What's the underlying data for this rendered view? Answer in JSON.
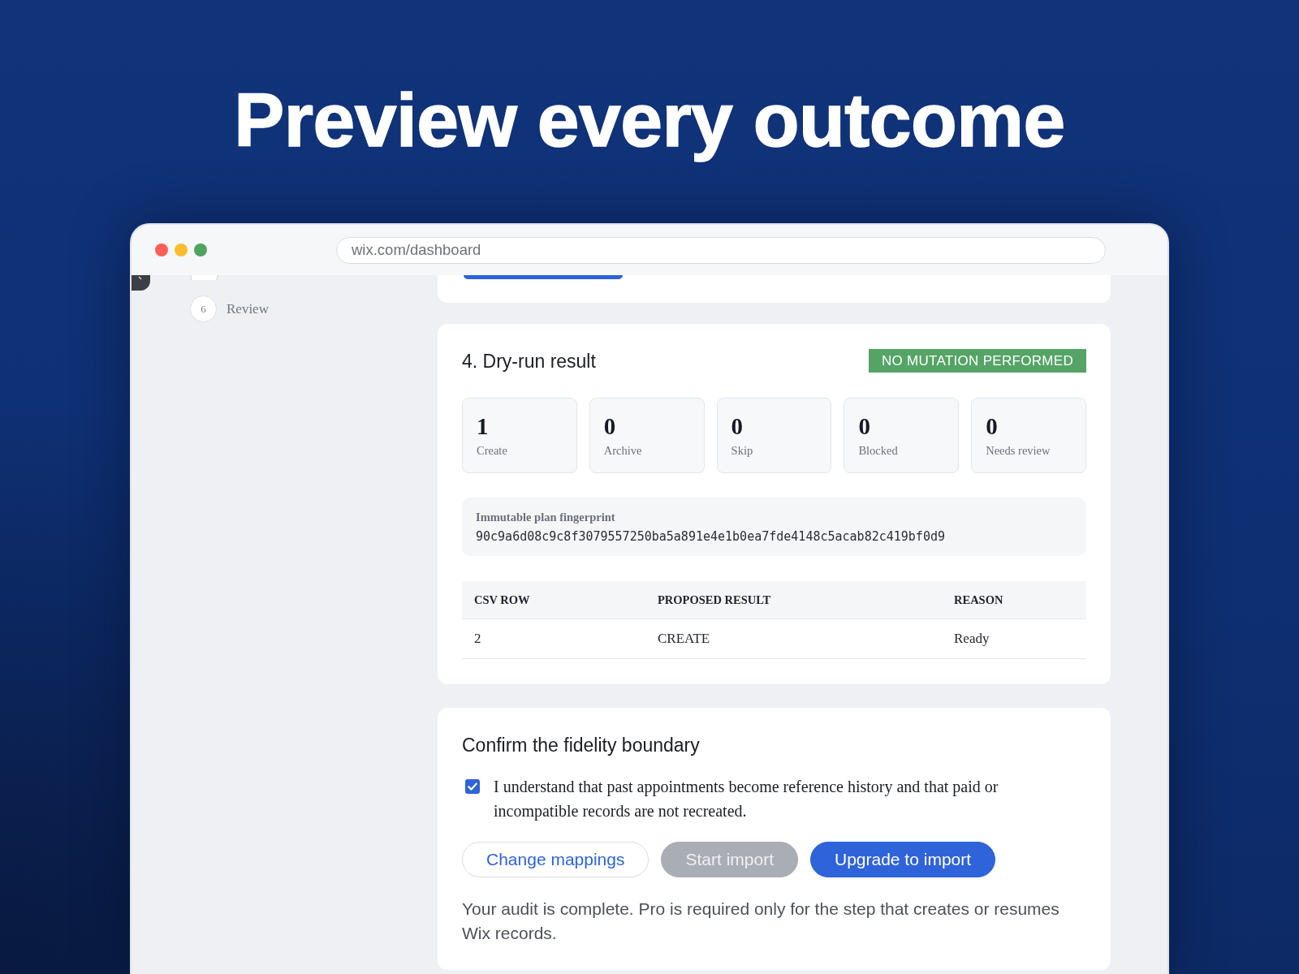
{
  "headline": "Preview every outcome",
  "browser": {
    "url": "wix.com/dashboard"
  },
  "sidebar": {
    "steps": [
      {
        "number": "6",
        "label": "Review"
      }
    ]
  },
  "dry_run": {
    "title": "4. Dry-run result",
    "badge": "NO MUTATION PERFORMED",
    "stats": [
      {
        "value": "1",
        "label": "Create"
      },
      {
        "value": "0",
        "label": "Archive"
      },
      {
        "value": "0",
        "label": "Skip"
      },
      {
        "value": "0",
        "label": "Blocked"
      },
      {
        "value": "0",
        "label": "Needs review"
      }
    ],
    "fingerprint": {
      "label": "Immutable plan fingerprint",
      "value": "90c9a6d08c9c8f3079557250ba5a891e4e1b0ea7fde4148c5acab82c419bf0d9"
    },
    "table": {
      "columns": [
        "CSV ROW",
        "PROPOSED RESULT",
        "REASON"
      ],
      "rows": [
        [
          "2",
          "CREATE",
          "Ready"
        ]
      ]
    }
  },
  "confirm": {
    "title": "Confirm the fidelity boundary",
    "checkbox": {
      "label": "I understand that past appointments become reference history and that paid or incompatible records are not recreated.",
      "checked": true
    },
    "buttons": [
      {
        "label": "Change mappings",
        "kind": "secondary",
        "disabled": false
      },
      {
        "label": "Start import",
        "kind": "primary",
        "disabled": true
      },
      {
        "label": "Upgrade to import",
        "kind": "primary",
        "disabled": false
      }
    ],
    "note": "Your audit is complete. Pro is required only for the step that creates or resumes Wix records."
  }
}
